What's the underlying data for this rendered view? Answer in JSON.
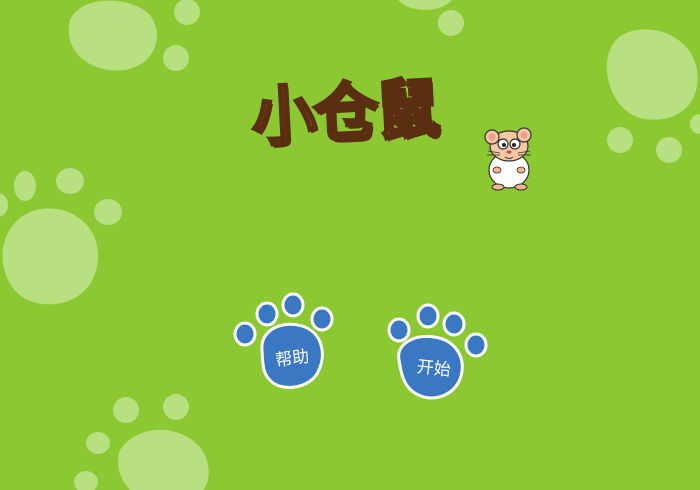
{
  "game": {
    "title": "小仓鼠",
    "help_label": "帮助",
    "start_label": "开始"
  },
  "colors": {
    "background": "#8cc832",
    "background_paw": "#b8df80",
    "button_paw": "#3a78c4",
    "button_outline": "#ffffff",
    "title_fill": "#b5642a",
    "title_outline": "#5a2e10"
  },
  "icons": {
    "mascot": "hamster-icon",
    "buttons": "paw-icon",
    "decoration": "paw-print-icon"
  }
}
